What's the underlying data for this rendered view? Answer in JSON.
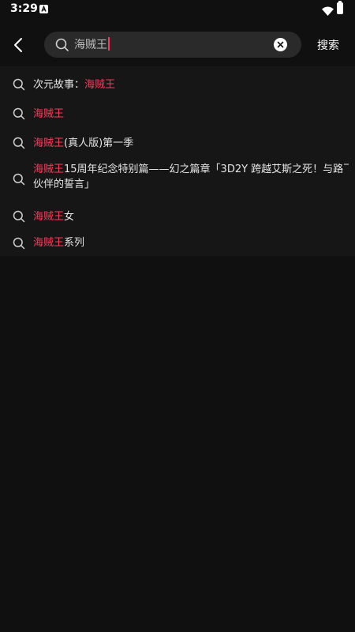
{
  "status_bar": {
    "time": "3:29"
  },
  "header": {
    "back_icon": "chevron-left-icon",
    "search_query": "海贼王",
    "clear_icon": "close-icon",
    "search_button_label": "搜索"
  },
  "colors": {
    "highlight": "#ff3b5c",
    "caret": "#ff3366",
    "background": "#101010",
    "panel": "#161616"
  },
  "suggestions": [
    {
      "prefix": "次元故事：",
      "match": "海贼王",
      "suffix": ""
    },
    {
      "prefix": "",
      "match": "海贼王",
      "suffix": ""
    },
    {
      "prefix": "",
      "match": "海贼王",
      "suffix": "(真人版)第一季"
    },
    {
      "prefix": "",
      "match": "海贼王",
      "suffix": "15周年纪念特别篇——幻之篇章「3D2Y 跨越艾斯之死！与路飞",
      "suffix_line2": "伙伴的誓言」"
    },
    {
      "prefix": "",
      "match": "海贼王",
      "suffix": "女"
    },
    {
      "prefix": "",
      "match": "海贼王",
      "suffix": "系列"
    }
  ]
}
